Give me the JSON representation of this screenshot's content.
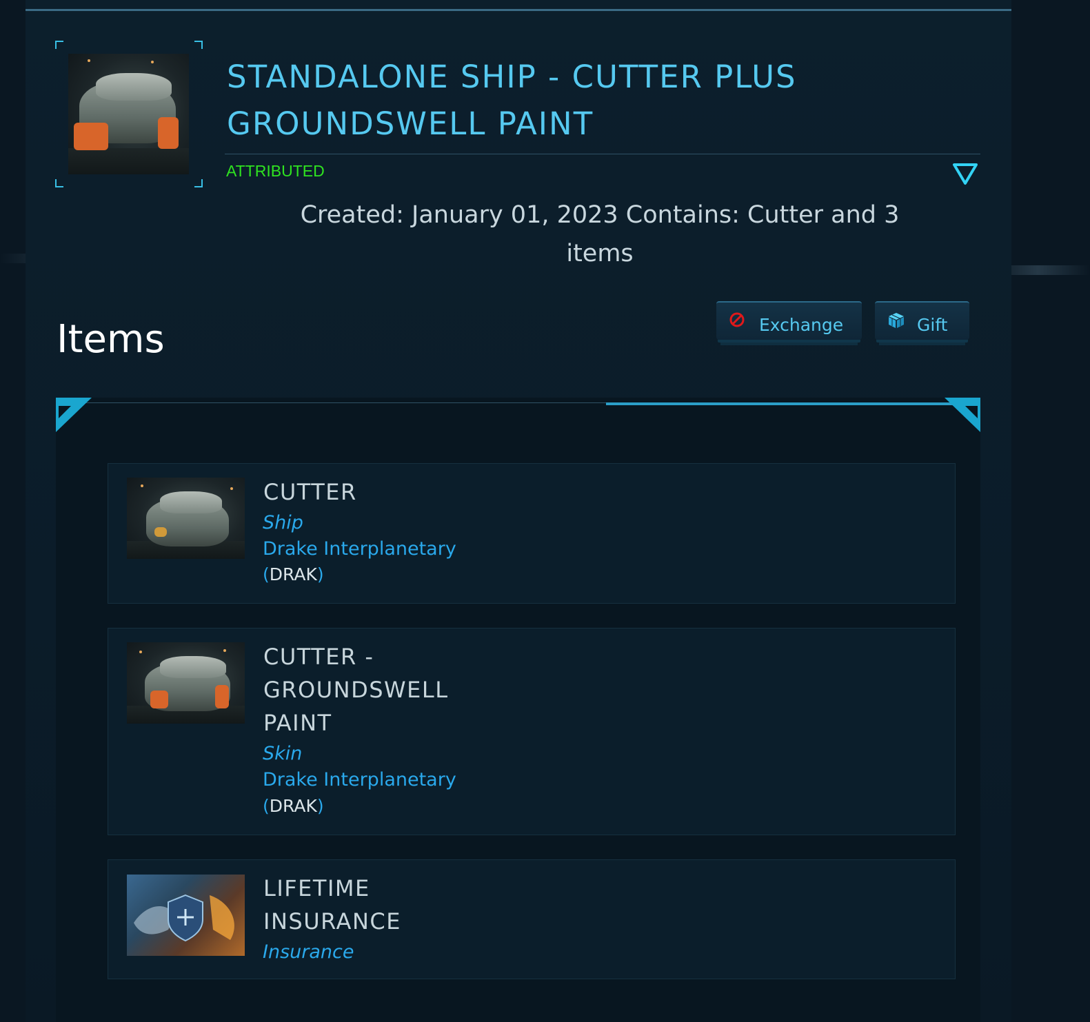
{
  "pledge": {
    "title_line1": "STANDALONE SHIP - CUTTER PLUS",
    "title_line2": "GROUNDSWELL PAINT",
    "status": "ATTRIBUTED",
    "created_line1": "Created: January 01, 2023 Contains: Cutter and 3",
    "created_line2": "items"
  },
  "actions": {
    "exchange_label": "Exchange",
    "gift_label": "Gift"
  },
  "items_heading": "Items",
  "items": [
    {
      "title_lines": [
        "CUTTER"
      ],
      "type": "Ship",
      "manufacturer": "Drake Interplanetary",
      "code_open": "(",
      "code": "DRAK",
      "code_close": ")"
    },
    {
      "title_lines": [
        "CUTTER -",
        "GROUNDSWELL",
        "PAINT"
      ],
      "type": "Skin",
      "manufacturer": "Drake Interplanetary",
      "code_open": "(",
      "code": "DRAK",
      "code_close": ")"
    },
    {
      "title_lines": [
        "LIFETIME",
        "INSURANCE"
      ],
      "type": "Insurance"
    }
  ],
  "colors": {
    "accent": "#56c9f0",
    "attributed": "#2fe320",
    "link": "#2aa9ec",
    "exchange_icon": "#e0191b"
  }
}
